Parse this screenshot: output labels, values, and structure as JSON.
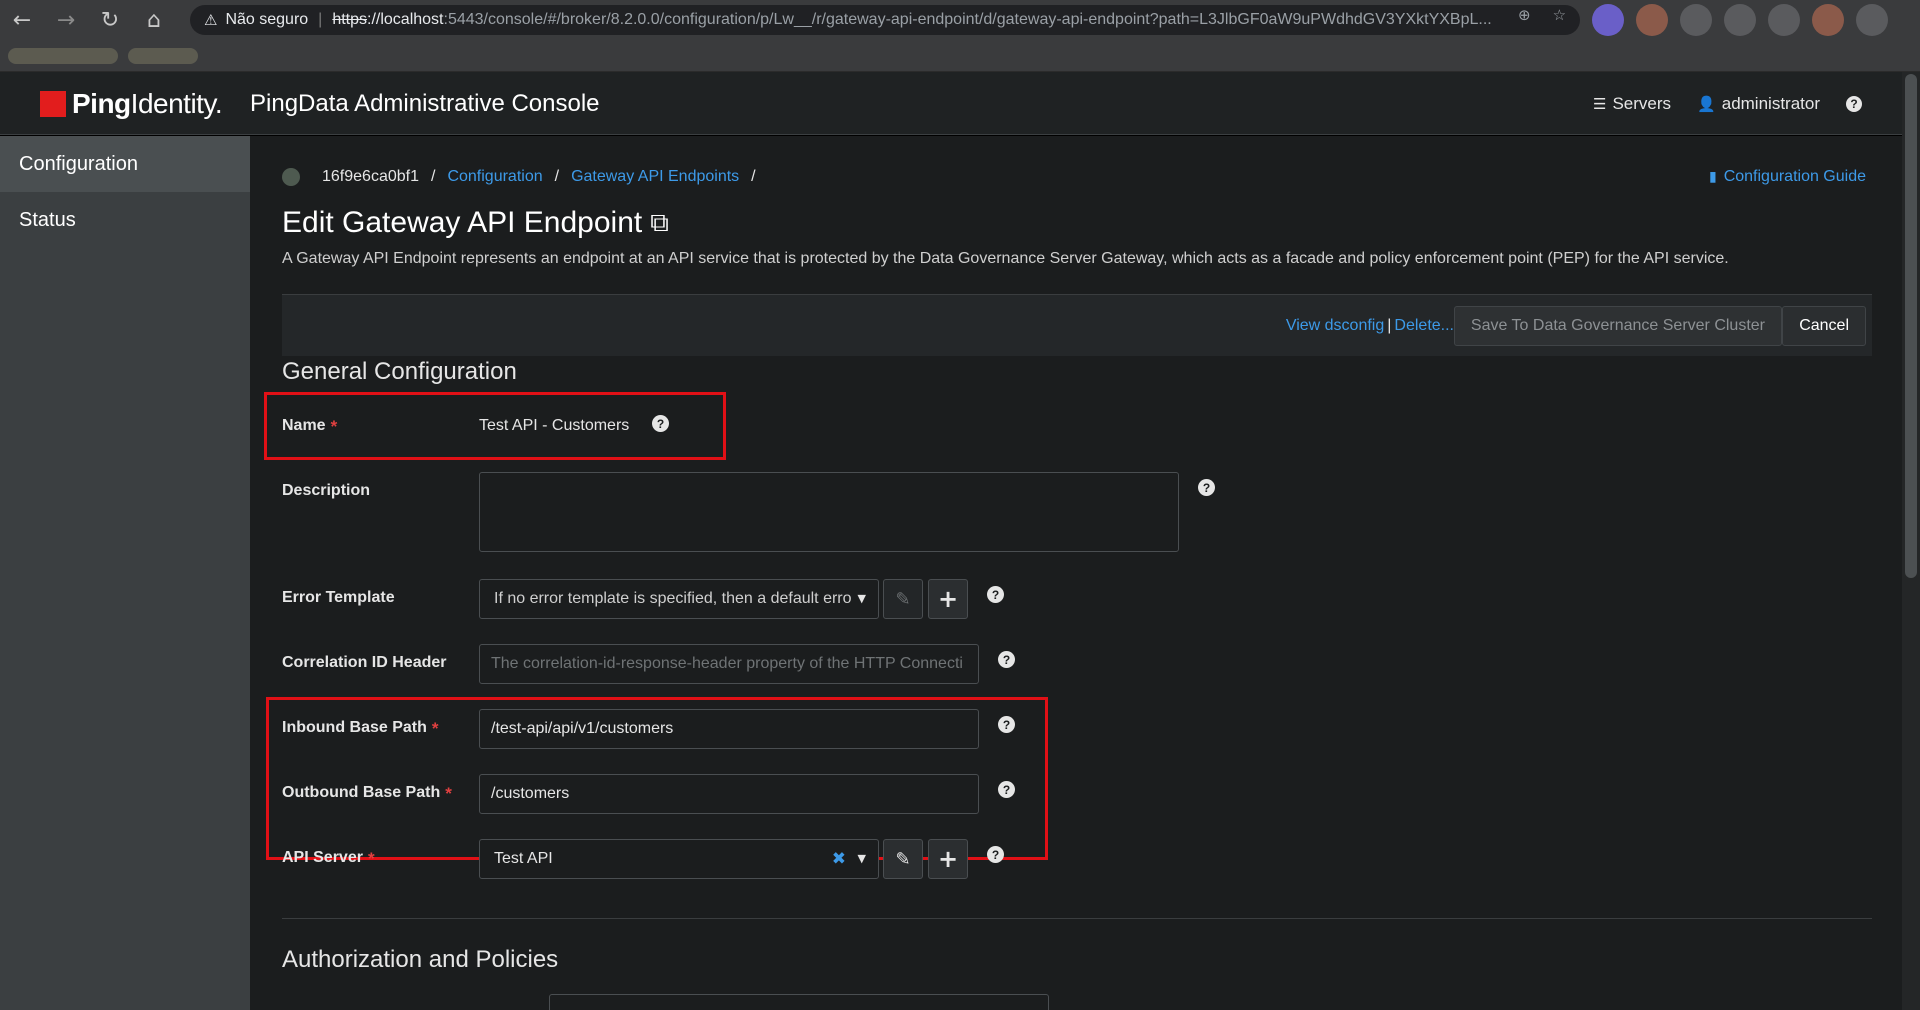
{
  "browser": {
    "security_label": "Não seguro",
    "url_scheme": "https",
    "url_host": "://localhost",
    "url_path": ":5443/console/#/broker/8.2.0.0/configuration/p/Lw__/r/gateway-api-endpoint/d/gateway-api-endpoint?path=L3JlbGF0aW9uPWdhdGV3YXktYXBpL..."
  },
  "header": {
    "logo_bold": "Ping",
    "logo_rest": "Identity.",
    "app_title": "PingData Administrative Console",
    "servers_label": "Servers",
    "user_label": "administrator",
    "help_glyph": "?"
  },
  "sidebar": {
    "items": [
      {
        "label": "Configuration",
        "active": true
      },
      {
        "label": "Status",
        "active": false
      }
    ]
  },
  "breadcrumb": {
    "server": "16f9e6ca0bf1",
    "items": [
      "Configuration",
      "Gateway API Endpoints"
    ],
    "separator": "/"
  },
  "guide_link": "Configuration Guide",
  "page": {
    "title": "Edit Gateway API Endpoint",
    "description": "A Gateway API Endpoint represents an endpoint at an API service that is protected by the Data Governance Server Gateway, which acts as a facade and policy enforcement point (PEP) for the API service."
  },
  "toolbar": {
    "view_dsconfig": "View dsconfig",
    "pipe": "|",
    "delete": "Delete...",
    "save": "Save To Data Governance Server Cluster",
    "cancel": "Cancel"
  },
  "general": {
    "title": "General Configuration",
    "required_mark": "*",
    "name_label": "Name",
    "name_value": "Test API - Customers",
    "description_label": "Description",
    "description_value": "",
    "error_template_label": "Error Template",
    "error_template_placeholder": "If no error template is specified, then a default erro",
    "correlation_label": "Correlation ID Header",
    "correlation_placeholder": "The correlation-id-response-header property of the HTTP Connecti",
    "inbound_label": "Inbound Base Path",
    "inbound_value": "/test-api/api/v1/customers",
    "outbound_label": "Outbound Base Path",
    "outbound_value": "/customers",
    "api_server_label": "API Server",
    "api_server_value": "Test API"
  },
  "authorization": {
    "title": "Authorization and Policies"
  },
  "colors": {
    "accent": "#3d9ae8",
    "required": "#e14040",
    "highlight": "#e11016",
    "brand": "#e21d1d"
  }
}
